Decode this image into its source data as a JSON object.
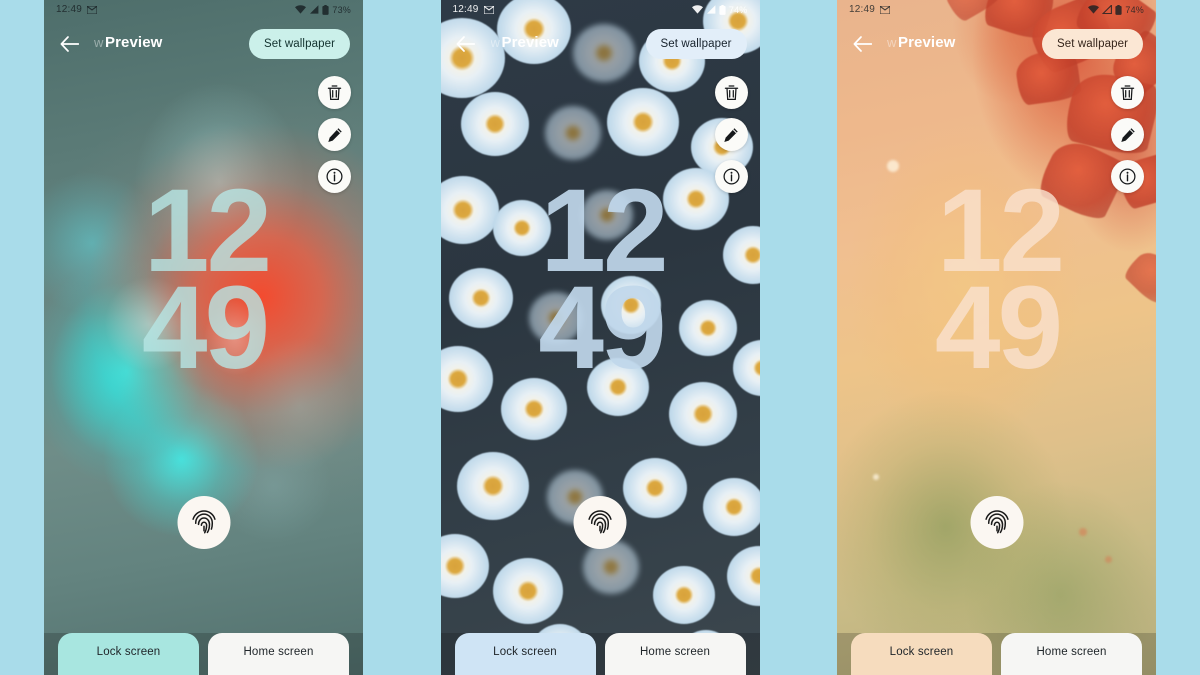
{
  "page": {
    "background_color": "#a9dcea",
    "screenshot_size": "1200x675"
  },
  "phones": [
    {
      "id": "phone-ink",
      "wallpaper_name": "teal-red-ink-smoke",
      "status_bar": {
        "time": "12:49",
        "notification_icon": "sms-icon",
        "wifi_icon": "wifi-icon",
        "signal_icon": "cellular-signal-icon",
        "battery_icon": "battery-icon",
        "battery_percent": "73%",
        "text_color": "#1a2226"
      },
      "app_bar": {
        "back_icon": "back-arrow-icon",
        "title": "Preview",
        "ghost_title": "w",
        "set_wallpaper_label": "Set wallpaper",
        "set_wallpaper_bg": "#cbf0ea",
        "set_wallpaper_text": "#13322f"
      },
      "actions": [
        {
          "name": "delete-button",
          "icon": "trash-icon"
        },
        {
          "name": "edit-button",
          "icon": "pencil-icon"
        },
        {
          "name": "info-button",
          "icon": "info-icon"
        }
      ],
      "clock": {
        "hours": "12",
        "minutes": "49",
        "color": "rgba(183,230,229,0.80)"
      },
      "fingerprint_icon": "fingerprint-icon",
      "tabs": [
        {
          "label": "Lock screen",
          "selected": true,
          "color": "#a8e6e0"
        },
        {
          "label": "Home screen",
          "selected": false,
          "color": "#f6f6f4"
        }
      ]
    },
    {
      "id": "phone-flowers",
      "wallpaper_name": "navy-pale-blue-flowers",
      "status_bar": {
        "time": "12:49",
        "notification_icon": "sms-icon",
        "wifi_icon": "wifi-icon",
        "signal_icon": "cellular-signal-icon",
        "battery_icon": "battery-icon",
        "battery_percent": "74%",
        "text_color": "#ffffff"
      },
      "app_bar": {
        "back_icon": "back-arrow-icon",
        "title": "Preview",
        "ghost_title": "w",
        "set_wallpaper_label": "Set wallpaper",
        "set_wallpaper_bg": "#e2eef9",
        "set_wallpaper_text": "#17222c"
      },
      "actions": [
        {
          "name": "delete-button",
          "icon": "trash-icon"
        },
        {
          "name": "edit-button",
          "icon": "pencil-icon"
        },
        {
          "name": "info-button",
          "icon": "info-icon"
        }
      ],
      "clock": {
        "hours": "12",
        "minutes": "49",
        "color": "rgba(192,215,234,0.92)"
      },
      "fingerprint_icon": "fingerprint-icon",
      "tabs": [
        {
          "label": "Lock screen",
          "selected": true,
          "color": "#cfe4f5"
        },
        {
          "label": "Home screen",
          "selected": false,
          "color": "#f6f6f4"
        }
      ]
    },
    {
      "id": "phone-autumn",
      "wallpaper_name": "autumn-maple-leaves",
      "status_bar": {
        "time": "12:49",
        "notification_icon": "sms-icon",
        "wifi_icon": "wifi-icon",
        "signal_icon": "cellular-signal-icon",
        "battery_icon": "battery-icon",
        "battery_percent": "74%",
        "text_color": "#2a1f18"
      },
      "app_bar": {
        "back_icon": "back-arrow-icon",
        "title": "Preview",
        "ghost_title": "w",
        "set_wallpaper_label": "Set wallpaper",
        "set_wallpaper_bg": "#fbe7d4",
        "set_wallpaper_text": "#35241a"
      },
      "actions": [
        {
          "name": "delete-button",
          "icon": "trash-icon"
        },
        {
          "name": "edit-button",
          "icon": "pencil-icon"
        },
        {
          "name": "info-button",
          "icon": "info-icon"
        }
      ],
      "clock": {
        "hours": "12",
        "minutes": "49",
        "color": "rgba(249,225,205,0.82)"
      },
      "fingerprint_icon": "fingerprint-icon",
      "tabs": [
        {
          "label": "Lock screen",
          "selected": true,
          "color": "#f6dcbe"
        },
        {
          "label": "Home screen",
          "selected": false,
          "color": "#f6f6f4"
        }
      ]
    }
  ]
}
